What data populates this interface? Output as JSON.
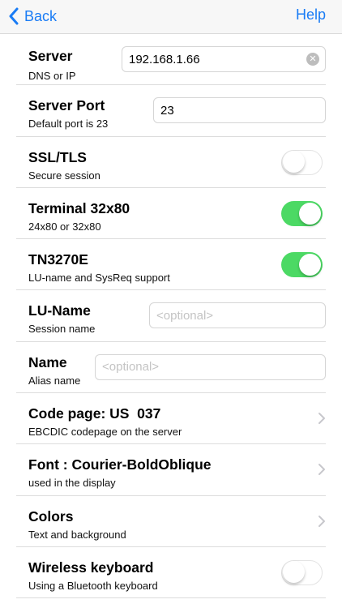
{
  "nav": {
    "back_label": "Back",
    "help_label": "Help"
  },
  "rows": [
    {
      "title": "Server",
      "subtitle": "DNS or IP",
      "control": "text",
      "value": "192.168.1.66",
      "placeholder": ""
    },
    {
      "title": "Server Port",
      "subtitle": "Default port is 23",
      "control": "text",
      "value": "23",
      "placeholder": ""
    },
    {
      "title": "SSL/TLS",
      "subtitle": "Secure session",
      "control": "toggle",
      "on": false
    },
    {
      "title": "Terminal 32x80",
      "subtitle": "24x80 or 32x80",
      "control": "toggle",
      "on": true
    },
    {
      "title": "TN3270E",
      "subtitle": "LU-name and SysReq support",
      "control": "toggle",
      "on": true
    },
    {
      "title": "LU-Name",
      "subtitle": "Session name",
      "control": "text",
      "value": "",
      "placeholder": "<optional>"
    },
    {
      "title": "Name",
      "subtitle": "Alias name",
      "control": "text",
      "value": "",
      "placeholder": "<optional>"
    },
    {
      "title": "Code page: US  037",
      "subtitle": "EBCDIC codepage on the server",
      "control": "disclosure"
    },
    {
      "title": "Font : Courier-BoldOblique",
      "subtitle": "used in the display",
      "control": "disclosure"
    },
    {
      "title": "Colors",
      "subtitle": "Text and background",
      "control": "disclosure"
    },
    {
      "title": "Wireless keyboard",
      "subtitle": "Using a Bluetooth keyboard",
      "control": "toggle",
      "on": false
    }
  ],
  "colors": {
    "accent": "#1a7cf5",
    "toggle_on": "#4cd964",
    "separator": "#dcdcdc"
  },
  "icons": {
    "back": "chevron-left-icon",
    "clear": "clear-circle-icon",
    "disclosure": "chevron-right-icon"
  }
}
